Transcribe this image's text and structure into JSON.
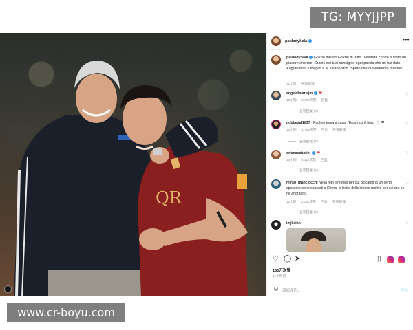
{
  "watermark_top": "TG: MYYJJPP",
  "watermark_bottom": "www.cr-boyu.com",
  "post": {
    "author": "paulodybala",
    "caption_author": "paulodybala",
    "caption": "Grazie mister! Grazie di tutto.. lavorare con te è stato un piacere enorme. Grazie dei tuoi consigli e ogni parola che mi hai dato. Auguro tutto il meglio a te e il tuo staff. Spero che ci rivedremo presto!!",
    "caption_time": "11小时",
    "caption_translate": "查看翻译",
    "likes": "150万次赞",
    "time": "11小时前",
    "add_comment_placeholder": "添加评论...",
    "post_label": "发布"
  },
  "comments": [
    {
      "user": "angeldimariajm",
      "text": "",
      "time": "10小时",
      "likes": "8,772次赞",
      "reply": "回复",
      "view_replies": "查看回复 (25)"
    },
    {
      "user": "gobbedal1897_",
      "text": "Paulino toma a casa. l'Erasmus è finito",
      "time": "10小时",
      "likes": "1,749次赞",
      "reply": "回复",
      "translate": "查看翻译",
      "view_replies": "查看回复 (71)"
    },
    {
      "user": "orianasabatini",
      "text": "",
      "time": "10小时",
      "likes": "4,112次赞",
      "reply": "回复",
      "view_replies": "查看回复 (25)"
    },
    {
      "user": "mirko_manciocchi",
      "text": "Nella foto il motivo per cui giocatori di un certo spessore sono sbarcati a Roma: si tratta dello stesso motivo per cui ora se ne andranno.",
      "time": "11小时",
      "likes": "1,124次赞",
      "reply": "回复",
      "translate": "查看翻译",
      "view_replies": "查看回复 (29)"
    },
    {
      "user": "imjkalan",
      "text": ""
    }
  ],
  "icons": {
    "more": "more-icon",
    "heart": "heart-icon",
    "comment": "comment-icon",
    "share": "share-icon",
    "bookmark": "bookmark-icon",
    "emoji": "emoji-icon"
  },
  "colors": {
    "link": "#3897f0",
    "heart_red": "#ed4956",
    "muted": "#8e8e8e",
    "jersey": "#8a1f1f"
  }
}
